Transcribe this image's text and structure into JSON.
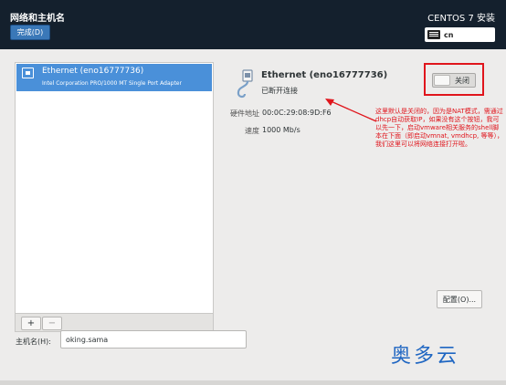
{
  "header": {
    "page_title": "网络和主机名",
    "done_button": "完成(D)",
    "install_title": "CENTOS 7 安装",
    "keyboard_layout": "cn"
  },
  "device_list": {
    "items": [
      {
        "name": "Ethernet (eno16777736)",
        "description": "Intel Corporation PRO/1000 MT Single Port Adapter"
      }
    ],
    "add_button": "+",
    "remove_button": "−"
  },
  "details": {
    "device_name": "Ethernet (eno16777736)",
    "status": "已断开连接",
    "toggle_label": "关闭",
    "hw_address_label": "硬件地址",
    "hw_address": "00:0C:29:08:9D:F6",
    "speed_label": "速度",
    "speed": "1000 Mb/s",
    "configure_button": "配置(O)..."
  },
  "annotation": {
    "text": "这里默认是关闭的，因为是NAT模式，需通过dhcp自动获取IP，如果没有这个按钮，我可以先一下，启动vmware相关服务的shell脚本在下面（即启动vmnat, vmdhcp, 等等），我们这里可以将网络连接打开啦。",
    "color": "#e0151c"
  },
  "hostname": {
    "label": "主机名(H):",
    "value": "oking.sama"
  },
  "watermark": "奥多云",
  "colors": {
    "header_bg": "#14202d",
    "accent": "#4a90d9",
    "highlight_box": "#e0151c"
  }
}
